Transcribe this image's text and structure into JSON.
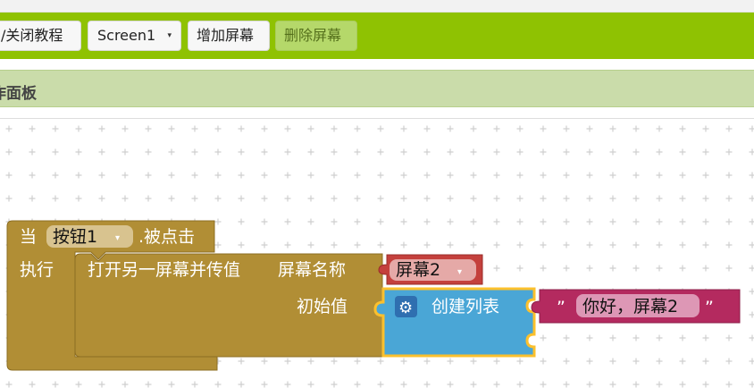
{
  "toolbar": {
    "tutorial_toggle": "/关闭教程",
    "screen_select": "Screen1",
    "screen_caret": "▾",
    "add_screen": "增加屏幕",
    "delete_screen": "删除屏幕"
  },
  "panel": {
    "title": "作面板"
  },
  "blocks": {
    "event": {
      "when": "当",
      "component": "按钮1",
      "dropdown": "▾",
      "event_name": ".被点击",
      "do": "执行"
    },
    "open_screen": {
      "label": "打开另一屏幕并传值",
      "screen_name_label": "屏幕名称",
      "screen_value": "屏幕2",
      "dropdown": "▾",
      "start_value_label": "初始值"
    },
    "list": {
      "label": "创建列表",
      "gear": "⚙"
    },
    "text": {
      "open_quote": "”",
      "value": "你好，屏幕2",
      "close_quote": "”"
    }
  },
  "colors": {
    "toolbar": "#8fc202",
    "panel_header": "#cadcaa",
    "event_block": "#b18e35",
    "screen_block": "#c4403c",
    "list_block": "#4aa6d6",
    "text_block": "#b42a5f",
    "selection": "#fbc02d"
  }
}
